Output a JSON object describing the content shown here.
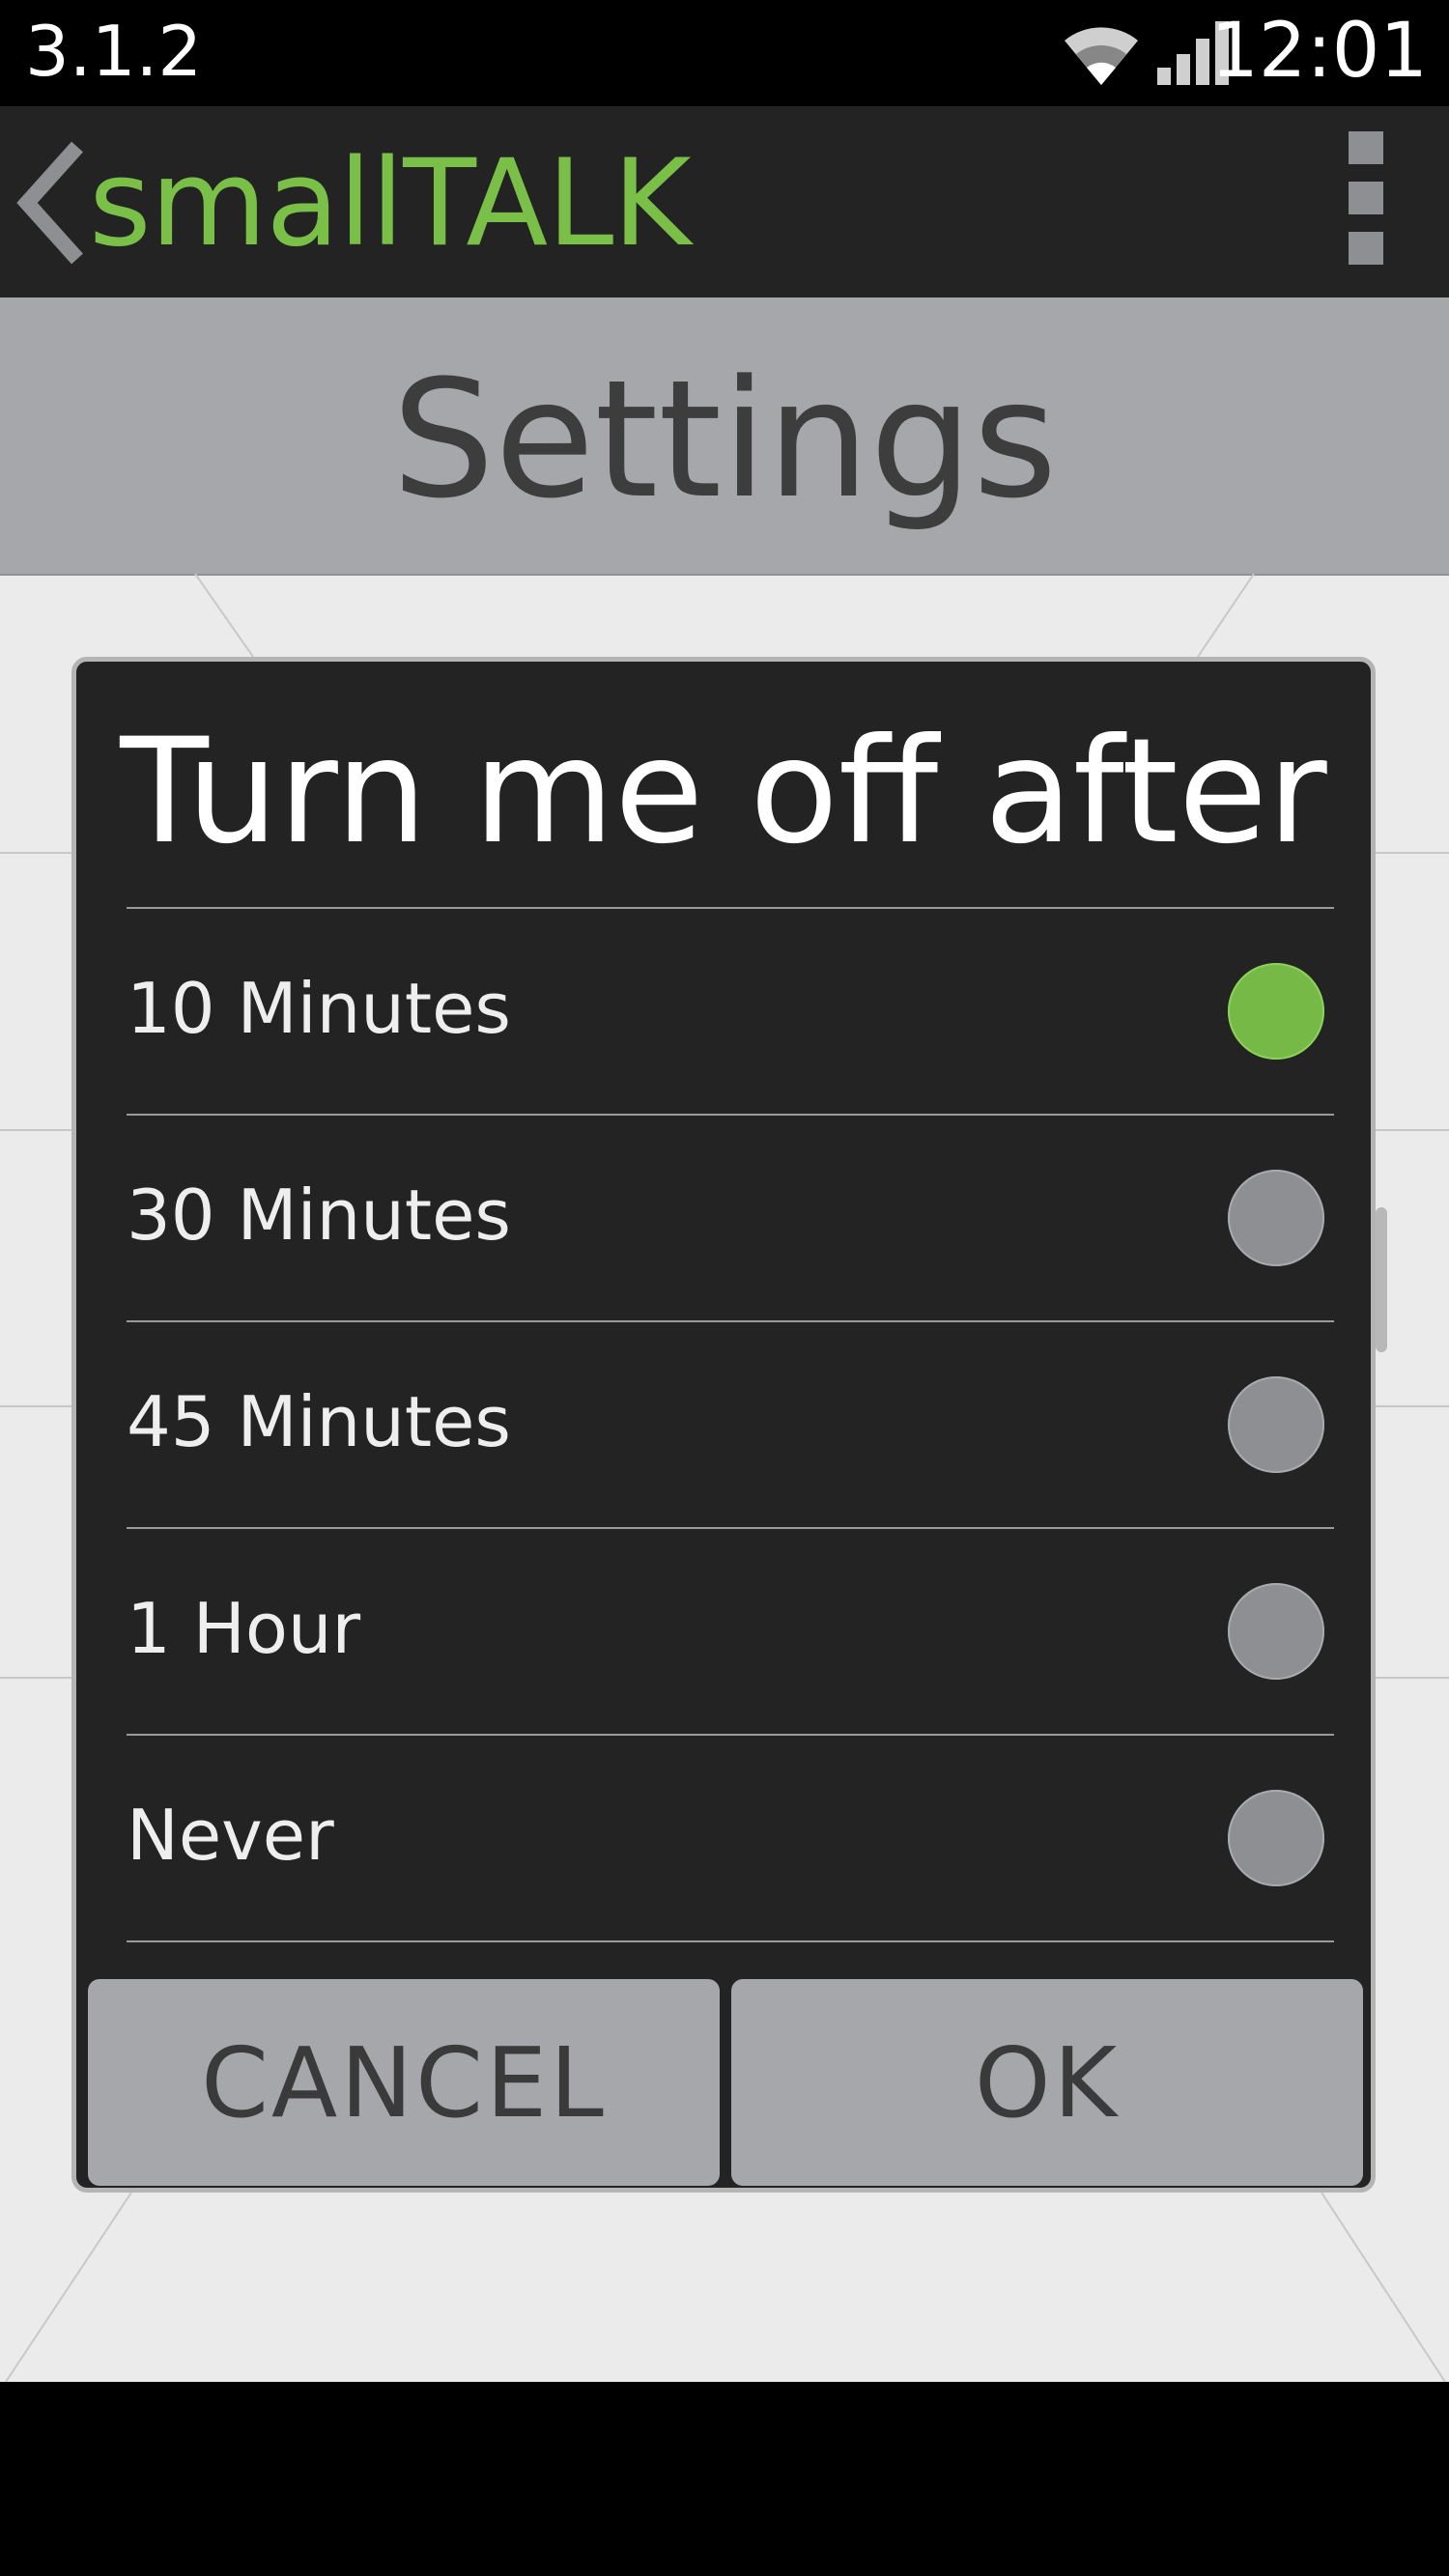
{
  "status_bar": {
    "version": "3.1.2",
    "time": "12:01",
    "icons": [
      "wifi-icon",
      "signal-icon"
    ]
  },
  "action_bar": {
    "app_title": "smallTALK",
    "back_icon": "chevron-left-icon",
    "menu_icon": "overflow-menu-icon",
    "colors": {
      "title": "#7abf48",
      "background": "#232323"
    }
  },
  "settings": {
    "title": "Settings"
  },
  "dialog": {
    "title": "Turn me off after",
    "selected_index": 0,
    "options": [
      {
        "label": "10 Minutes",
        "checked": true
      },
      {
        "label": "30 Minutes",
        "checked": false
      },
      {
        "label": "45 Minutes",
        "checked": false
      },
      {
        "label": "1 Hour",
        "checked": false
      },
      {
        "label": "Never",
        "checked": false
      }
    ],
    "cancel_label": "CANCEL",
    "ok_label": "OK",
    "colors": {
      "radio_checked": "#76b946",
      "radio_unchecked": "#8e8f92"
    }
  }
}
